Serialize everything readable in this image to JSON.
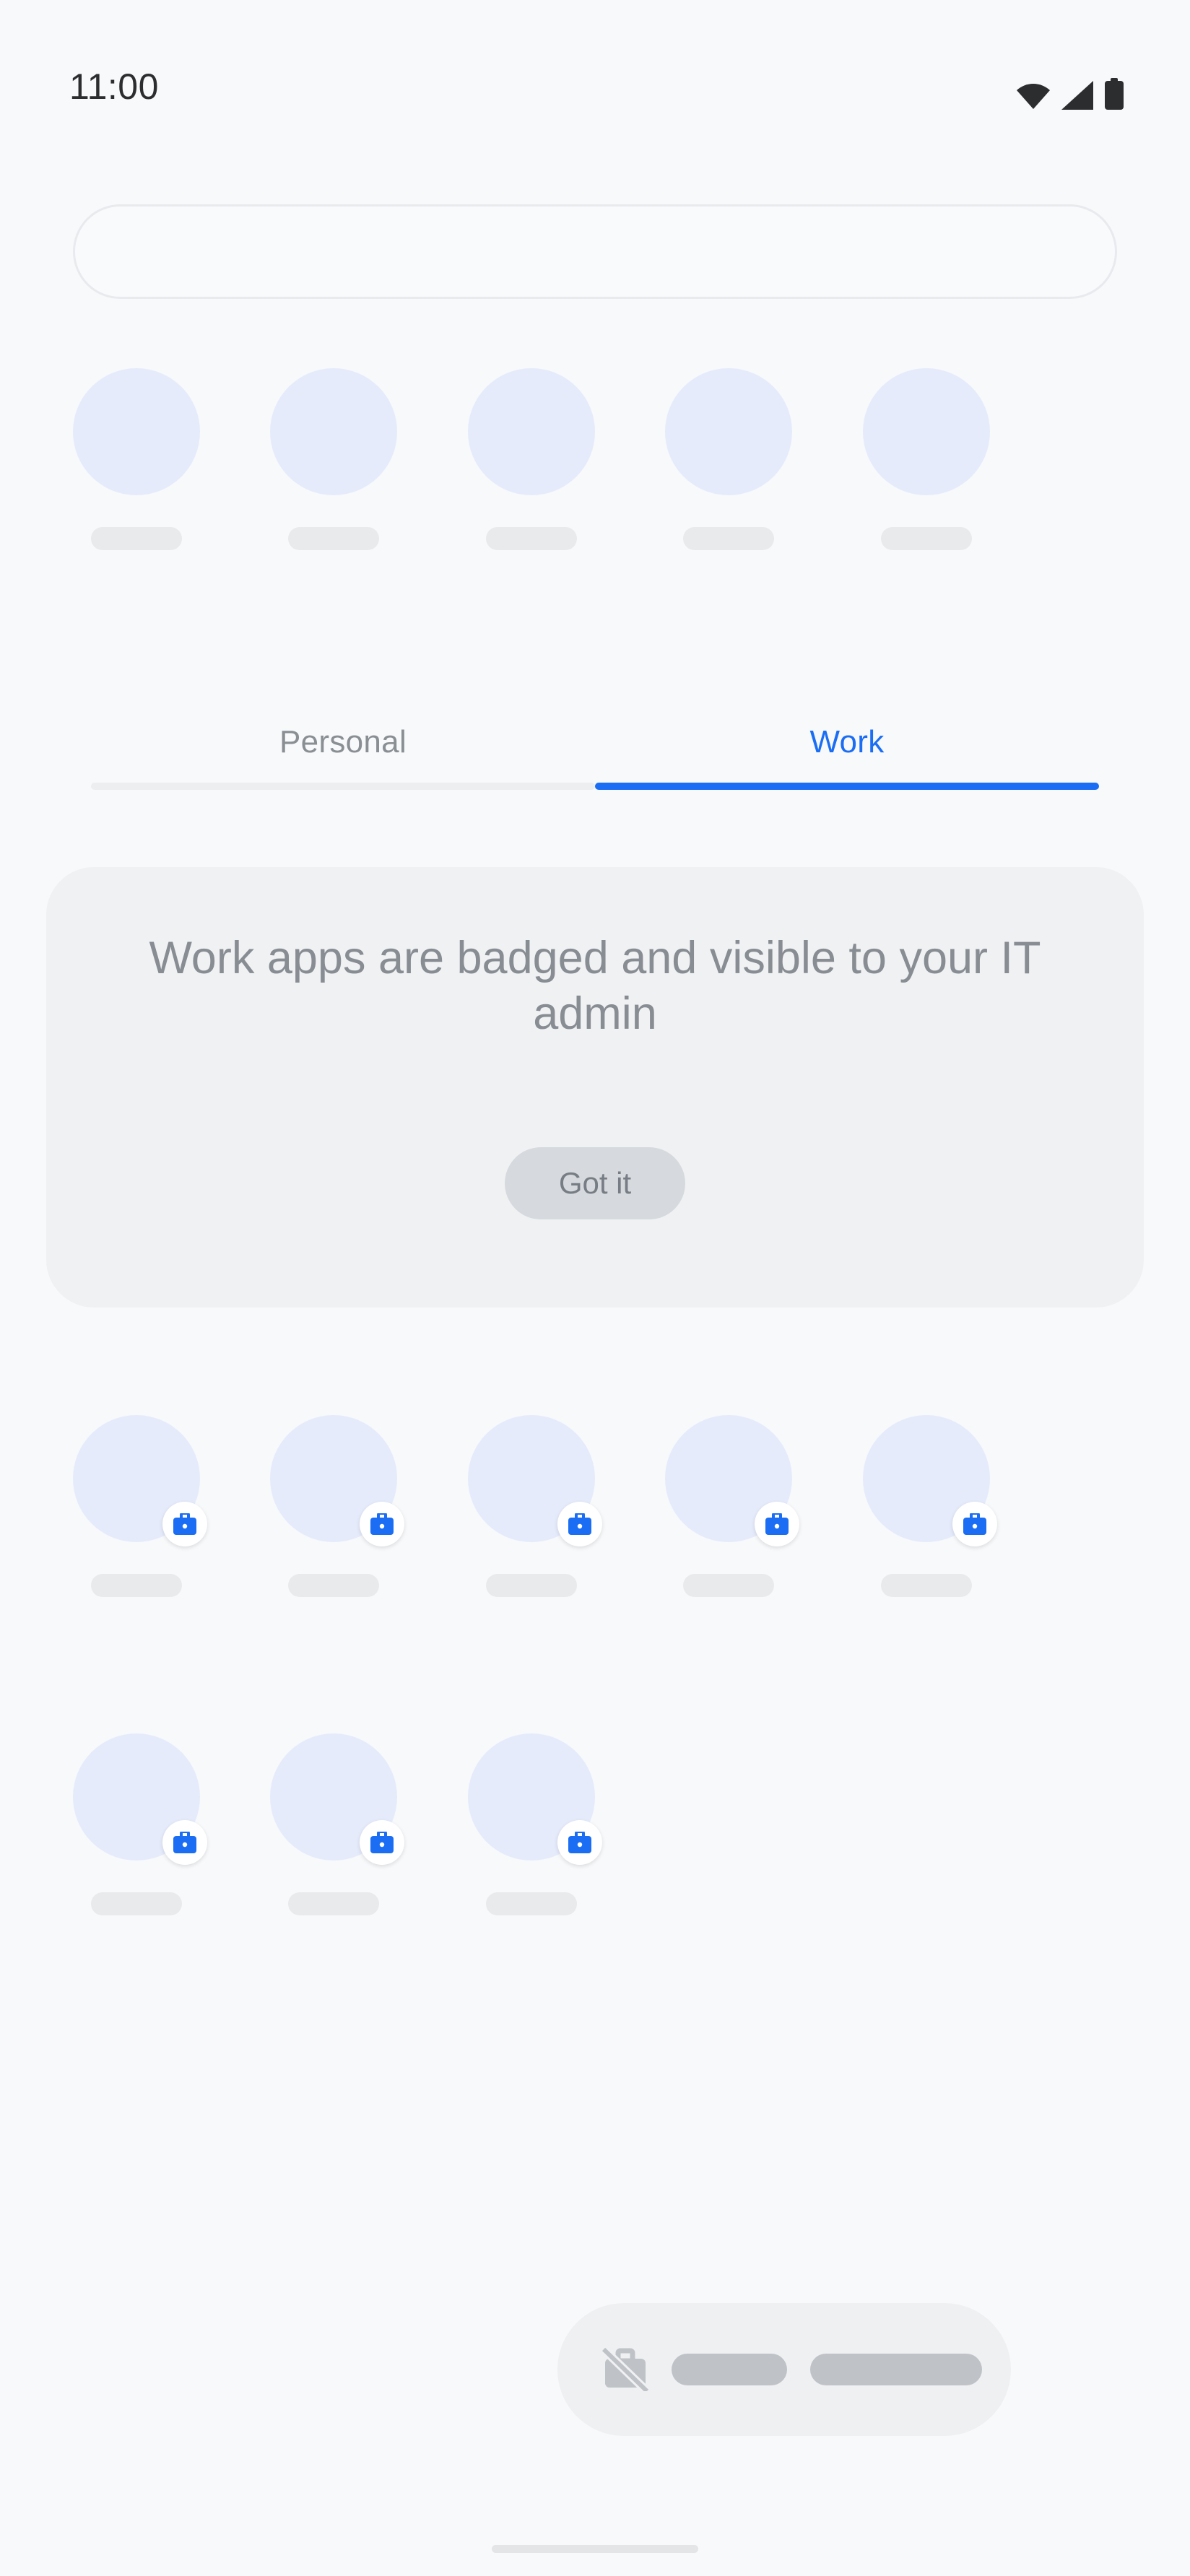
{
  "status_bar": {
    "clock": "11:00",
    "icons": [
      "wifi-icon",
      "cell-signal-icon",
      "battery-icon"
    ]
  },
  "search": {
    "value": "",
    "placeholder": ""
  },
  "predicted_row": {
    "items": [
      {
        "icon": "app-icon-placeholder",
        "label": ""
      },
      {
        "icon": "app-icon-placeholder",
        "label": ""
      },
      {
        "icon": "app-icon-placeholder",
        "label": ""
      },
      {
        "icon": "app-icon-placeholder",
        "label": ""
      },
      {
        "icon": "app-icon-placeholder",
        "label": ""
      }
    ]
  },
  "tabs": {
    "personal_label": "Personal",
    "work_label": "Work",
    "active": "Work",
    "active_color": "#1b6ef3",
    "inactive_color": "#8a8f94"
  },
  "info_card": {
    "message": "Work apps are badged and visible to your IT admin",
    "button_label": "Got it"
  },
  "work_grid": {
    "badge_icon": "work-briefcase-badge-icon",
    "badge_color": "#1b6ef3",
    "row1": [
      {
        "icon": "app-icon-placeholder",
        "label": "",
        "badged": true
      },
      {
        "icon": "app-icon-placeholder",
        "label": "",
        "badged": true
      },
      {
        "icon": "app-icon-placeholder",
        "label": "",
        "badged": true
      },
      {
        "icon": "app-icon-placeholder",
        "label": "",
        "badged": true
      },
      {
        "icon": "app-icon-placeholder",
        "label": "",
        "badged": true
      }
    ],
    "row2": [
      {
        "icon": "app-icon-placeholder",
        "label": "",
        "badged": true
      },
      {
        "icon": "app-icon-placeholder",
        "label": "",
        "badged": true
      },
      {
        "icon": "app-icon-placeholder",
        "label": "",
        "badged": true
      }
    ]
  },
  "work_bar": {
    "icon": "work-profile-off-icon",
    "toggle_label": "",
    "status_label": ""
  },
  "colors": {
    "page_background": "#f7f9fb",
    "app_icon_placeholder": "#e5ebfb",
    "label_placeholder": "#e9eaec",
    "card_background": "#f0f1f3",
    "accent_blue": "#1b6ef3"
  }
}
